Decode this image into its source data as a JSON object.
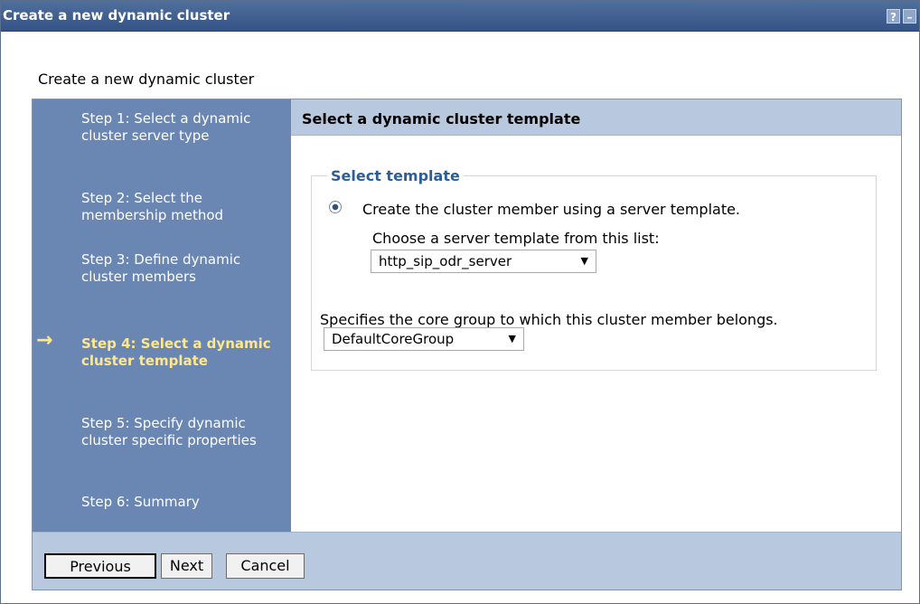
{
  "window": {
    "title": "Create a new dynamic cluster",
    "help_icon": "?",
    "minimize_icon": "–"
  },
  "page": {
    "heading": "Create a new dynamic cluster"
  },
  "steps": [
    {
      "label": "Step 1: Select a dynamic cluster server type"
    },
    {
      "label": "Step 2: Select the membership method"
    },
    {
      "label": "Step 3: Define dynamic cluster members"
    },
    {
      "label": "Step 4: Select a dynamic cluster template"
    },
    {
      "label": "Step 5: Specify dynamic cluster specific properties"
    },
    {
      "label": "Step 6: Summary"
    }
  ],
  "current_step_arrow": "→",
  "content": {
    "header": "Select a dynamic cluster template",
    "section_title": "Select template",
    "radio_label": "Create the cluster member using a server template.",
    "list_label": "Choose a server template from this list:",
    "template_select_value": "http_sip_odr_server",
    "core_group_label": "Specifies the core group to which this cluster member belongs.",
    "core_group_select_value": "DefaultCoreGroup"
  },
  "buttons": {
    "previous": "Previous",
    "next": "Next",
    "cancel": "Cancel"
  },
  "colors": {
    "titlebar": "#355386",
    "sidebar": "#6a86b2",
    "current_step": "#ffe88a",
    "header_bg": "#b8c8df",
    "section_title": "#2f5d95"
  }
}
